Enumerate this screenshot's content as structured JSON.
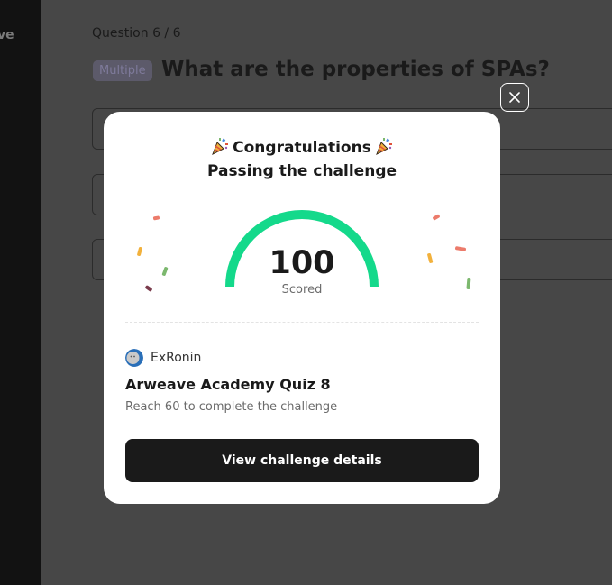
{
  "sidebar": {
    "partial_label": "ve"
  },
  "question": {
    "number_label": "Question 6 / 6",
    "type_badge": "Multiple",
    "title": "What are the properties of SPAs?"
  },
  "modal": {
    "congrats": "Congratulations",
    "subtitle": "Passing the challenge",
    "score": "100",
    "score_caption": "Scored",
    "score_fraction": 1.0,
    "author": "ExRonin",
    "quiz_title": "Arweave Academy Quiz 8",
    "requirement": "Reach 60 to complete the challenge",
    "cta_label": "View challenge details"
  },
  "colors": {
    "gauge": "#14d98b",
    "overlay": "#474747",
    "cta_bg": "#1a1a1a"
  },
  "icons": [
    "party-popper-icon",
    "close-icon",
    "avatar"
  ]
}
